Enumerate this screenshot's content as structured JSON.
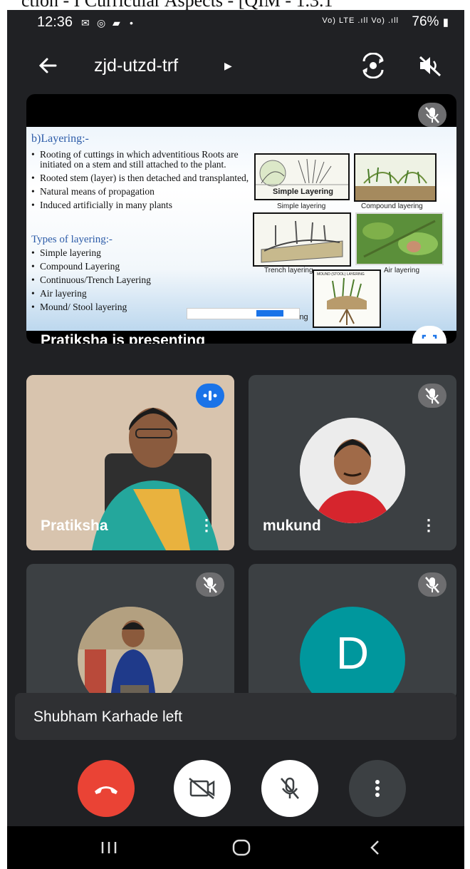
{
  "page_header": {
    "text": "ction - I Curricular Aspects - [QIM - 1.3.1"
  },
  "status_bar": {
    "time": "12:36",
    "network": "Vo) LTE .ıll Vo) .ıll",
    "battery": "76%"
  },
  "meeting": {
    "code": "zjd-utzd-trf"
  },
  "presentation": {
    "label": "Pratiksha is presenting",
    "slide": {
      "heading": "b)Layering:-",
      "bullets": [
        "Rooting of cuttings in which adventitious Roots are initiated on a stem and still attached to the plant.",
        "Rooted stem (layer) is then detached and transplanted,",
        "Natural means of propagation",
        "Induced artificially in many plants"
      ],
      "types_heading": "Types of layering:-",
      "types": [
        "Simple layering",
        "Compound Layering",
        "Continuous/Trench Layering",
        "Air layering",
        "Mound/ Stool layering"
      ],
      "image_captions": {
        "simple_label": "Simple Layering",
        "simple": "Simple layering",
        "compound": "Compound layering",
        "trench": "Trench layering",
        "air": "Air layering",
        "mound": "MOUND (STOOL) LAYERING",
        "trailing": "ing"
      }
    }
  },
  "participants": [
    {
      "name": "Pratiksha"
    },
    {
      "name": "mukund"
    },
    {
      "name": ""
    },
    {
      "name": "",
      "initial": "D"
    }
  ],
  "toast": {
    "message": "Shubham Karhade left"
  },
  "colors": {
    "end_call": "#ea4335",
    "avatar_d": "#00979d",
    "speaking": "#1a73e8"
  }
}
